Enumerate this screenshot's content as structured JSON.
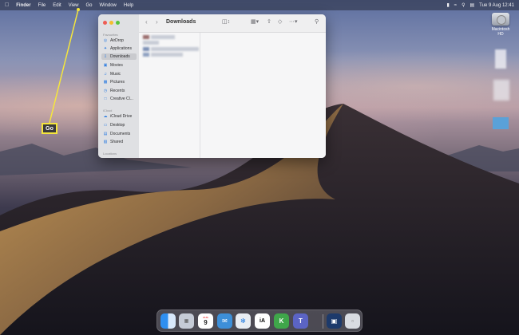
{
  "menubar": {
    "apple": "",
    "items": [
      "Finder",
      "File",
      "Edit",
      "View",
      "Go",
      "Window",
      "Help"
    ],
    "clock": "Tue 9 Aug  12:41"
  },
  "desktop": {
    "drive_label": "Macintosh HD"
  },
  "callout": {
    "label": "Go",
    "color": "#f5e63c"
  },
  "finder": {
    "title": "Downloads",
    "sidebar": {
      "favorites_header": "Favourites",
      "favorites": [
        {
          "icon": "airdrop-icon",
          "label": "AirDrop"
        },
        {
          "icon": "applications-icon",
          "label": "Applications"
        },
        {
          "icon": "downloads-icon",
          "label": "Downloads"
        },
        {
          "icon": "movies-icon",
          "label": "Movies"
        },
        {
          "icon": "music-icon",
          "label": "Music"
        },
        {
          "icon": "pictures-icon",
          "label": "Pictures"
        },
        {
          "icon": "recents-icon",
          "label": "Recents"
        },
        {
          "icon": "creative-cloud-icon",
          "label": "Creative Cl..."
        }
      ],
      "icloud_header": "iCloud",
      "icloud": [
        {
          "icon": "icloud-drive-icon",
          "label": "iCloud Drive"
        },
        {
          "icon": "desktop-icon",
          "label": "Desktop"
        },
        {
          "icon": "documents-icon",
          "label": "Documents"
        },
        {
          "icon": "shared-icon",
          "label": "Shared"
        }
      ],
      "locations_header": "Locations"
    }
  },
  "dock": {
    "calendar_month": "AUG",
    "calendar_day": "9",
    "ia_writer_label": "iA"
  }
}
